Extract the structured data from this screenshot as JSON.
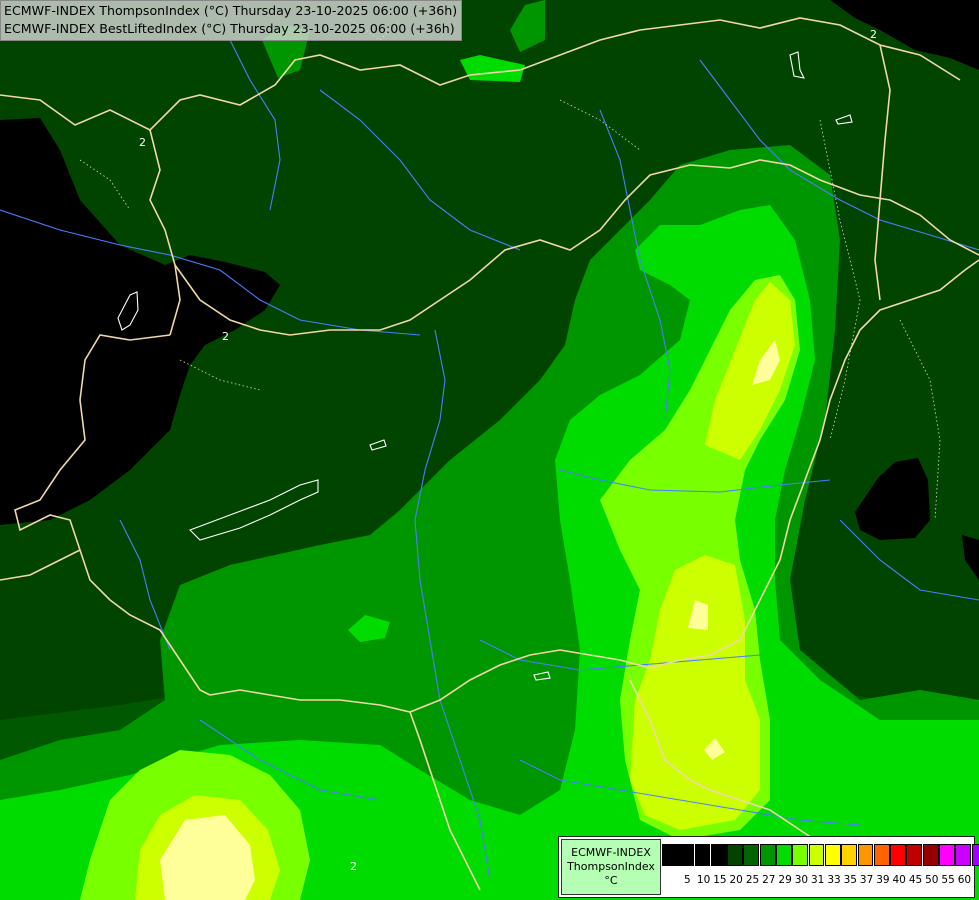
{
  "title_lines": [
    "ECMWF-INDEX ThompsonIndex (°C) Thursday 23-10-2025 06:00 (+36h)",
    "ECMWF-INDEX BestLiftedIndex (°C) Thursday 23-10-2025 06:00 (+36h)"
  ],
  "legend": {
    "model": "ECMWF-INDEX",
    "parameter": "ThompsonIndex",
    "unit": "°C",
    "ticks": [
      "5",
      "10",
      "15",
      "20",
      "25",
      "27",
      "29",
      "30",
      "31",
      "33",
      "35",
      "37",
      "39",
      "40",
      "45",
      "50",
      "55",
      "60"
    ],
    "colors": [
      "#000000",
      "#000000",
      "#000000",
      "#000000",
      "#004400",
      "#006400",
      "#009600",
      "#00dc00",
      "#78ff00",
      "#ccff00",
      "#ffff00",
      "#ffd200",
      "#ff9600",
      "#ff6400",
      "#ff0000",
      "#c00000",
      "#960000",
      "#ff00ff",
      "#cc00ff",
      "#a000ff",
      "#6400ff",
      "#0000ff"
    ]
  },
  "contour_labels": [
    "2",
    "2",
    "2",
    "2"
  ],
  "colors": {
    "background": "#004400",
    "band_dark": "#005a00",
    "band_mid": "#009600",
    "band_bright": "#00dc00",
    "band_lime": "#78ff00",
    "band_yellowgreen": "#ccff00",
    "band_paleyellow": "#ffff99",
    "black": "#000000",
    "border": "#f0d8a8",
    "river": "#4a7dff"
  }
}
